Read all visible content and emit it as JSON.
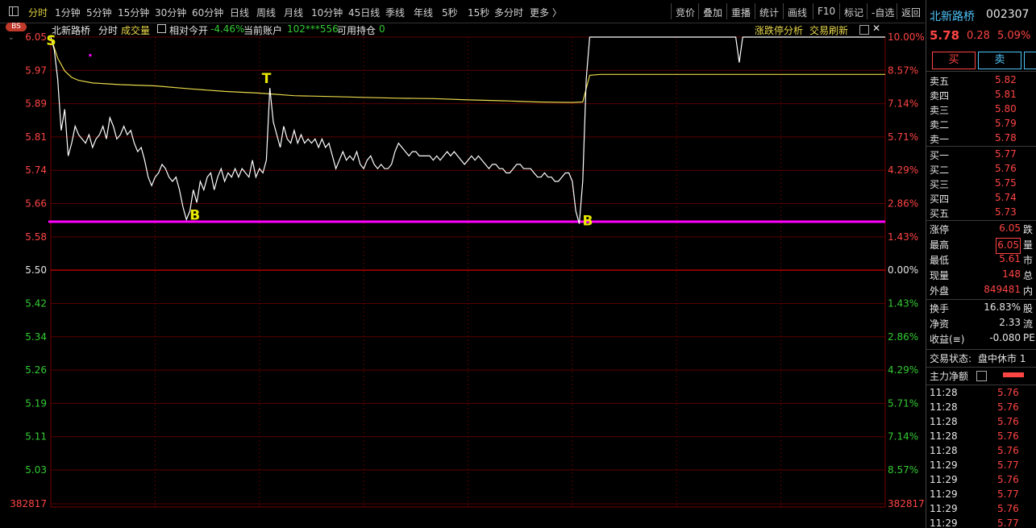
{
  "toolbar": {
    "tabs": [
      "分时",
      "1分钟",
      "5分钟",
      "15分钟",
      "30分钟",
      "60分钟",
      "日线",
      "周线",
      "月线",
      "10分钟",
      "45日线",
      "季线",
      "年线",
      "5秒",
      "15秒",
      "多分时",
      "更多 〉"
    ],
    "active_tab": "分时",
    "right_buttons": [
      "竞价",
      "叠加",
      "重播",
      "统计",
      "画线",
      "F10",
      "标记",
      "-自选",
      "返回"
    ]
  },
  "info": {
    "stock_name": "北新路桥",
    "mode": "分时",
    "volume_label": "成交量",
    "relative_open_label": "相对今开",
    "relative_open_value": "-4.46%",
    "account_label": "当前账户",
    "account_value": "102***556",
    "holdings_label": "可用持仓",
    "holdings_value": "0",
    "limit_analysis": "涨跌停分析",
    "trade_refresh": "交易刷新",
    "bs_badge": "BS"
  },
  "chart_data": {
    "type": "line",
    "title": "北新路桥 分时",
    "price_ticks": [
      "6.05",
      "5.97",
      "5.89",
      "5.81",
      "5.74",
      "5.66",
      "5.58",
      "5.50",
      "5.42",
      "5.34",
      "5.26",
      "5.19",
      "5.11",
      "5.03"
    ],
    "pct_ticks": [
      "10.00%",
      "8.57%",
      "7.14%",
      "5.71%",
      "4.29%",
      "2.86%",
      "1.43%",
      "0.00%",
      "1.43%",
      "2.86%",
      "4.29%",
      "5.71%",
      "7.14%",
      "8.57%"
    ],
    "volume_tick": "382817",
    "ylim": [
      5.03,
      6.05
    ],
    "prev_close": 5.5,
    "support_line": 5.615,
    "x_domain": [
      0,
      240
    ],
    "price_series": [
      [
        0,
        6.05
      ],
      [
        1,
        6.02
      ],
      [
        2,
        5.95
      ],
      [
        3,
        5.83
      ],
      [
        4,
        5.88
      ],
      [
        5,
        5.77
      ],
      [
        6,
        5.8
      ],
      [
        7,
        5.84
      ],
      [
        8,
        5.82
      ],
      [
        9,
        5.81
      ],
      [
        10,
        5.8
      ],
      [
        11,
        5.82
      ],
      [
        12,
        5.79
      ],
      [
        13,
        5.81
      ],
      [
        14,
        5.82
      ],
      [
        15,
        5.84
      ],
      [
        16,
        5.81
      ],
      [
        17,
        5.86
      ],
      [
        18,
        5.84
      ],
      [
        19,
        5.81
      ],
      [
        20,
        5.82
      ],
      [
        21,
        5.84
      ],
      [
        22,
        5.82
      ],
      [
        23,
        5.83
      ],
      [
        24,
        5.8
      ],
      [
        25,
        5.78
      ],
      [
        26,
        5.79
      ],
      [
        27,
        5.76
      ],
      [
        28,
        5.72
      ],
      [
        29,
        5.7
      ],
      [
        30,
        5.72
      ],
      [
        31,
        5.73
      ],
      [
        32,
        5.75
      ],
      [
        33,
        5.74
      ],
      [
        34,
        5.72
      ],
      [
        35,
        5.71
      ],
      [
        36,
        5.72
      ],
      [
        37,
        5.69
      ],
      [
        38,
        5.65
      ],
      [
        39,
        5.62
      ],
      [
        40,
        5.64
      ],
      [
        41,
        5.69
      ],
      [
        42,
        5.66
      ],
      [
        43,
        5.71
      ],
      [
        44,
        5.69
      ],
      [
        45,
        5.72
      ],
      [
        46,
        5.73
      ],
      [
        47,
        5.69
      ],
      [
        48,
        5.72
      ],
      [
        49,
        5.74
      ],
      [
        50,
        5.71
      ],
      [
        51,
        5.73
      ],
      [
        52,
        5.72
      ],
      [
        53,
        5.74
      ],
      [
        54,
        5.72
      ],
      [
        55,
        5.74
      ],
      [
        56,
        5.73
      ],
      [
        57,
        5.72
      ],
      [
        58,
        5.76
      ],
      [
        59,
        5.72
      ],
      [
        60,
        5.74
      ],
      [
        61,
        5.73
      ],
      [
        62,
        5.76
      ],
      [
        63,
        5.93
      ],
      [
        64,
        5.85
      ],
      [
        65,
        5.82
      ],
      [
        66,
        5.79
      ],
      [
        67,
        5.84
      ],
      [
        68,
        5.81
      ],
      [
        69,
        5.8
      ],
      [
        70,
        5.83
      ],
      [
        71,
        5.8
      ],
      [
        72,
        5.82
      ],
      [
        73,
        5.8
      ],
      [
        74,
        5.81
      ],
      [
        75,
        5.8
      ],
      [
        76,
        5.81
      ],
      [
        77,
        5.79
      ],
      [
        78,
        5.81
      ],
      [
        79,
        5.79
      ],
      [
        80,
        5.8
      ],
      [
        81,
        5.77
      ],
      [
        82,
        5.74
      ],
      [
        83,
        5.76
      ],
      [
        84,
        5.78
      ],
      [
        85,
        5.76
      ],
      [
        86,
        5.77
      ],
      [
        87,
        5.76
      ],
      [
        88,
        5.78
      ],
      [
        89,
        5.75
      ],
      [
        90,
        5.74
      ],
      [
        91,
        5.76
      ],
      [
        92,
        5.77
      ],
      [
        93,
        5.75
      ],
      [
        94,
        5.74
      ],
      [
        95,
        5.75
      ],
      [
        96,
        5.74
      ],
      [
        97,
        5.74
      ],
      [
        98,
        5.75
      ],
      [
        99,
        5.78
      ],
      [
        100,
        5.8
      ],
      [
        101,
        5.79
      ],
      [
        102,
        5.78
      ],
      [
        103,
        5.77
      ],
      [
        104,
        5.78
      ],
      [
        105,
        5.78
      ],
      [
        106,
        5.77
      ],
      [
        107,
        5.77
      ],
      [
        108,
        5.77
      ],
      [
        109,
        5.77
      ],
      [
        110,
        5.76
      ],
      [
        111,
        5.77
      ],
      [
        112,
        5.76
      ],
      [
        113,
        5.77
      ],
      [
        114,
        5.78
      ],
      [
        115,
        5.77
      ],
      [
        116,
        5.78
      ],
      [
        117,
        5.77
      ],
      [
        118,
        5.76
      ],
      [
        119,
        5.75
      ],
      [
        120,
        5.76
      ],
      [
        121,
        5.77
      ],
      [
        122,
        5.76
      ],
      [
        123,
        5.77
      ],
      [
        124,
        5.76
      ],
      [
        125,
        5.75
      ],
      [
        126,
        5.74
      ],
      [
        127,
        5.75
      ],
      [
        128,
        5.75
      ],
      [
        129,
        5.74
      ],
      [
        130,
        5.74
      ],
      [
        131,
        5.73
      ],
      [
        132,
        5.73
      ],
      [
        133,
        5.74
      ],
      [
        134,
        5.75
      ],
      [
        135,
        5.75
      ],
      [
        136,
        5.74
      ],
      [
        137,
        5.74
      ],
      [
        138,
        5.74
      ],
      [
        139,
        5.73
      ],
      [
        140,
        5.72
      ],
      [
        141,
        5.72
      ],
      [
        142,
        5.73
      ],
      [
        143,
        5.72
      ],
      [
        144,
        5.72
      ],
      [
        145,
        5.71
      ],
      [
        146,
        5.71
      ],
      [
        147,
        5.72
      ],
      [
        148,
        5.73
      ],
      [
        149,
        5.73
      ],
      [
        150,
        5.71
      ],
      [
        151,
        5.64
      ],
      [
        152,
        5.61
      ],
      [
        153,
        5.71
      ],
      [
        154,
        5.95
      ],
      [
        155,
        6.05
      ],
      [
        156,
        6.05
      ],
      [
        157,
        6.05
      ],
      [
        158,
        6.05
      ],
      [
        159,
        6.05
      ],
      [
        160,
        6.05
      ],
      [
        161,
        6.05
      ],
      [
        162,
        6.05
      ],
      [
        163,
        6.05
      ],
      [
        164,
        6.05
      ],
      [
        165,
        6.05
      ],
      [
        166,
        6.05
      ],
      [
        167,
        6.05
      ],
      [
        168,
        6.05
      ],
      [
        169,
        6.05
      ],
      [
        170,
        6.05
      ],
      [
        171,
        6.05
      ],
      [
        172,
        6.05
      ],
      [
        173,
        6.05
      ],
      [
        174,
        6.05
      ],
      [
        175,
        6.05
      ],
      [
        176,
        6.05
      ],
      [
        177,
        6.05
      ],
      [
        178,
        6.05
      ],
      [
        179,
        6.05
      ],
      [
        180,
        6.05
      ],
      [
        181,
        6.05
      ],
      [
        182,
        6.05
      ],
      [
        183,
        6.05
      ],
      [
        184,
        6.05
      ],
      [
        185,
        6.05
      ],
      [
        186,
        6.05
      ],
      [
        187,
        6.05
      ],
      [
        188,
        6.05
      ],
      [
        189,
        6.05
      ],
      [
        190,
        6.05
      ],
      [
        191,
        6.05
      ],
      [
        192,
        6.05
      ],
      [
        193,
        6.05
      ],
      [
        194,
        6.05
      ],
      [
        195,
        6.05
      ],
      [
        196,
        6.05
      ],
      [
        197,
        6.05
      ],
      [
        198,
        5.99
      ],
      [
        199,
        6.05
      ],
      [
        200,
        6.05
      ],
      [
        201,
        6.05
      ],
      [
        202,
        6.05
      ],
      [
        203,
        6.05
      ],
      [
        204,
        6.05
      ],
      [
        205,
        6.05
      ],
      [
        206,
        6.05
      ],
      [
        207,
        6.05
      ],
      [
        208,
        6.05
      ],
      [
        209,
        6.05
      ],
      [
        210,
        6.05
      ],
      [
        211,
        6.05
      ],
      [
        212,
        6.05
      ],
      [
        213,
        6.05
      ],
      [
        214,
        6.05
      ],
      [
        215,
        6.05
      ],
      [
        216,
        6.05
      ],
      [
        217,
        6.05
      ],
      [
        218,
        6.05
      ],
      [
        219,
        6.05
      ],
      [
        220,
        6.05
      ],
      [
        221,
        6.05
      ],
      [
        222,
        6.05
      ],
      [
        223,
        6.05
      ],
      [
        224,
        6.05
      ],
      [
        225,
        6.05
      ],
      [
        226,
        6.05
      ],
      [
        227,
        6.05
      ],
      [
        228,
        6.05
      ],
      [
        229,
        6.05
      ],
      [
        230,
        6.05
      ],
      [
        231,
        6.05
      ],
      [
        232,
        6.05
      ],
      [
        233,
        6.05
      ],
      [
        234,
        6.05
      ],
      [
        235,
        6.05
      ],
      [
        236,
        6.05
      ],
      [
        237,
        6.05
      ],
      [
        238,
        6.05
      ],
      [
        239,
        6.05
      ],
      [
        240,
        6.05
      ]
    ],
    "avg_series": [
      [
        0,
        6.05
      ],
      [
        2,
        6.0
      ],
      [
        4,
        5.97
      ],
      [
        6,
        5.955
      ],
      [
        8,
        5.948
      ],
      [
        12,
        5.942
      ],
      [
        20,
        5.938
      ],
      [
        30,
        5.935
      ],
      [
        40,
        5.928
      ],
      [
        50,
        5.922
      ],
      [
        60,
        5.918
      ],
      [
        70,
        5.912
      ],
      [
        80,
        5.91
      ],
      [
        90,
        5.908
      ],
      [
        100,
        5.906
      ],
      [
        110,
        5.905
      ],
      [
        120,
        5.902
      ],
      [
        130,
        5.9
      ],
      [
        140,
        5.897
      ],
      [
        150,
        5.896
      ],
      [
        153,
        5.897
      ],
      [
        155,
        5.96
      ],
      [
        158,
        5.962
      ],
      [
        170,
        5.962
      ],
      [
        200,
        5.962
      ],
      [
        240,
        5.962
      ]
    ],
    "markers": [
      {
        "label": "S",
        "x": 1,
        "price": 6.02,
        "color": "#e8e800"
      },
      {
        "label": "T",
        "x": 63,
        "price": 5.93,
        "color": "#e8e800"
      },
      {
        "label": "B",
        "x": 39,
        "price": 5.62,
        "color": "#e8e800"
      },
      {
        "label": "B",
        "x": 152,
        "price": 5.61,
        "color": "#e8e800"
      }
    ]
  },
  "quote": {
    "name": "北新路桥",
    "code": "002307",
    "price": "5.78",
    "change": "0.28",
    "change_pct": "5.09%",
    "buy_btn": "买",
    "sell_btn": "卖",
    "asks": [
      [
        "卖五",
        "5.82"
      ],
      [
        "卖四",
        "5.81"
      ],
      [
        "卖三",
        "5.80"
      ],
      [
        "卖二",
        "5.79"
      ],
      [
        "卖一",
        "5.78"
      ]
    ],
    "bids": [
      [
        "买一",
        "5.77"
      ],
      [
        "买二",
        "5.76"
      ],
      [
        "买三",
        "5.75"
      ],
      [
        "买四",
        "5.74"
      ],
      [
        "买五",
        "5.73"
      ]
    ],
    "stats": [
      {
        "label": "涨停",
        "value": "6.05",
        "extra": "跌"
      },
      {
        "label": "最高",
        "value": "6.05",
        "extra": "量"
      },
      {
        "label": "最低",
        "value": "5.61",
        "extra": "市"
      },
      {
        "label": "现量",
        "value": "148",
        "extra": "总"
      },
      {
        "label": "外盘",
        "value": "849481",
        "extra": "内"
      },
      {
        "label": "换手",
        "value": "16.83%",
        "extra": "股"
      },
      {
        "label": "净资",
        "value": "2.33",
        "extra": "流"
      },
      {
        "label": "收益(≡)",
        "value": "-0.080",
        "extra": "PE"
      }
    ],
    "status_label": "交易状态:",
    "status_value": "盘中休市 1",
    "main_flow_label": "主力净额",
    "ticks": [
      [
        "11:28",
        "5.76"
      ],
      [
        "11:28",
        "5.76"
      ],
      [
        "11:28",
        "5.76"
      ],
      [
        "11:28",
        "5.76"
      ],
      [
        "11:28",
        "5.76"
      ],
      [
        "11:29",
        "5.77"
      ],
      [
        "11:29",
        "5.76"
      ],
      [
        "11:29",
        "5.77"
      ],
      [
        "11:29",
        "5.76"
      ],
      [
        "11:29",
        "5.77"
      ]
    ]
  },
  "colors": {
    "up": "#ff4444",
    "down": "#33cc33",
    "grid": "#5a0000",
    "support": "#ff00ff",
    "price_line": "#ffffff",
    "avg_line": "#e8d84a"
  }
}
